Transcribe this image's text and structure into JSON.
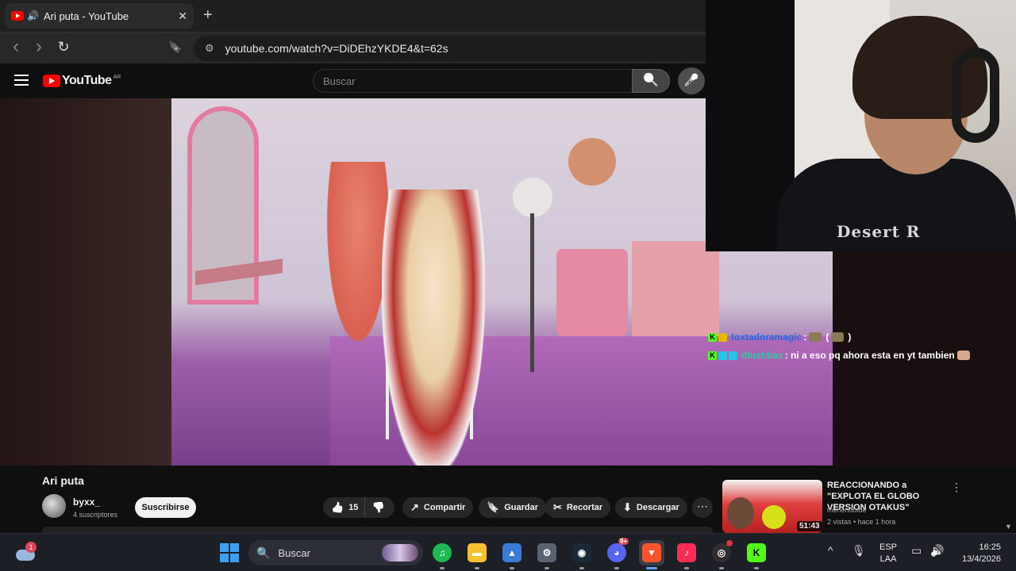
{
  "browser": {
    "tab_title": "Ari puta - YouTube",
    "tab_close": "✕",
    "new_tab": "+",
    "url": "youtube.com/watch?v=DiDEhzYKDE4&t=62s",
    "back_icon": "‹",
    "forward_icon": "›",
    "reload_icon": "↻",
    "bookmark_icon": "🔖",
    "tune_icon": "⚙"
  },
  "youtube": {
    "logo_text": "YouTube",
    "country_code": "AR",
    "search_placeholder": "Buscar",
    "search_icon": "🔍",
    "mic_icon": "🎤"
  },
  "chat": [
    {
      "user": "toxtadoramagic",
      "text": ":",
      "emote_text": "( ",
      "end": ")"
    },
    {
      "user": "dlushbax",
      "text": ": ni a eso pq ahora esta en yt tambien"
    }
  ],
  "webcam": {
    "shirt_text": "Desert R"
  },
  "video": {
    "title": "Ari puta",
    "channel": "byxx_",
    "subscribers": "4 suscriptores",
    "subscribe_label": "Suscribirse",
    "like_count": "15",
    "like_icon": "👍",
    "dislike_icon": "👎",
    "share_label": "Compartir",
    "share_icon": "↗",
    "save_label": "Guardar",
    "save_icon": "🔖",
    "clip_label": "Recortar",
    "clip_icon": "✂",
    "download_label": "Descargar",
    "download_icon": "⬇",
    "more_icon": "⋯"
  },
  "recommendation": {
    "title": "REACCIONANDO a \"EXPLOTA EL GLOBO VERSION OTAKUS\"",
    "channel": "meriendoide",
    "meta": "2 vistas • hace 1 hora",
    "duration": "51:43",
    "more_icon": "⋮",
    "scroll_arrow": "▼"
  },
  "taskbar": {
    "weather_badge": "1",
    "search_label": "Buscar",
    "search_icon": "🔍",
    "apps": [
      {
        "name": "spotify",
        "glyph": "♫",
        "color": "#1db954"
      },
      {
        "name": "file-explorer",
        "glyph": "▬",
        "color": "#f4c12f"
      },
      {
        "name": "photos",
        "glyph": "▲",
        "color": "#3a7bd5"
      },
      {
        "name": "settings",
        "glyph": "⚙",
        "color": "#5a6270"
      },
      {
        "name": "steam",
        "glyph": "◉",
        "color": "#1b2838"
      },
      {
        "name": "discord",
        "glyph": "◕",
        "color": "#5865f2"
      },
      {
        "name": "brave",
        "glyph": "▼",
        "color": "#fb542b"
      },
      {
        "name": "tiktok",
        "glyph": "♪",
        "color": "#fe2c55"
      },
      {
        "name": "obs",
        "glyph": "◎",
        "color": "#302e31"
      },
      {
        "name": "kick",
        "glyph": "K",
        "color": "#53fc18"
      }
    ],
    "discord_badge": "9+",
    "chevron_icon": "^",
    "mic_icon": "🎙",
    "lang_line1": "ESP",
    "lang_line2": "LAA",
    "network_icon": "▭",
    "volume_icon": "🔊",
    "time": "16:25",
    "date": "13/4/2026"
  }
}
